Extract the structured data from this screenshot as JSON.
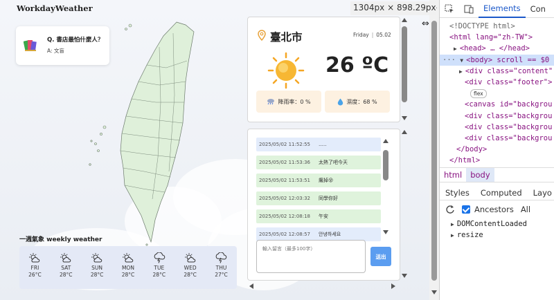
{
  "page": {
    "brand": "WorkdayWeather",
    "qa": {
      "question": "Q. 書店最怕什麼人？",
      "answer": "A: 文盲"
    },
    "weekly": {
      "title": "一週氣象 weekly weather",
      "days": [
        {
          "day": "FRI",
          "temp": "26°C",
          "icon": "partly-sunny-icon"
        },
        {
          "day": "SAT",
          "temp": "28°C",
          "icon": "partly-sunny-icon"
        },
        {
          "day": "SUN",
          "temp": "28°C",
          "icon": "partly-sunny-icon"
        },
        {
          "day": "MON",
          "temp": "28°C",
          "icon": "partly-sunny-icon"
        },
        {
          "day": "TUE",
          "temp": "28°C",
          "icon": "thunderstorm-icon"
        },
        {
          "day": "WED",
          "temp": "28°C",
          "icon": "partly-sunny-icon"
        },
        {
          "day": "THU",
          "temp": "27°C",
          "icon": "thunderstorm-icon"
        }
      ]
    },
    "current": {
      "city": "臺北市",
      "weekday": "Friday",
      "separator": "|",
      "date": "05.02",
      "temperature": "26 ºC",
      "rain": "降雨率：0 %",
      "humidity": "濕度：68 %"
    },
    "chat": {
      "messages": [
        {
          "time": "2025/05/02 11:52:55",
          "text": "…..",
          "color": "blue"
        },
        {
          "time": "2025/05/02 11:53:36",
          "text": "太熱了吧今天",
          "color": "green"
        },
        {
          "time": "2025/05/02 11:53:51",
          "text": "癱掉😵",
          "color": "green"
        },
        {
          "time": "2025/05/02 12:03:32",
          "text": "同學你好",
          "color": "green"
        },
        {
          "time": "2025/05/02 12:08:18",
          "text": "午安",
          "color": "green"
        },
        {
          "time": "2025/05/02 12:08:57",
          "text": "안녕하세요",
          "color": "blue"
        }
      ],
      "placeholder": "輸入留言（最多100字）",
      "send": "送出"
    }
  },
  "viewport_size": "1304px × 898.29px",
  "devtools": {
    "tabs": [
      "Elements",
      "Con"
    ],
    "code": [
      "<!DOCTYPE html>",
      "<html lang=\"zh-TW\">",
      "<head> … </head>",
      "<body> scroll == $0",
      "<div class=\"content\"",
      "<div class=\"footer\">",
      "flex",
      "<canvas id=\"backgrou",
      "<div class=\"backgrou",
      "<div class=\"backgrou",
      "<div class=\"backgrou",
      "</body>",
      "</html>"
    ],
    "crumbs": [
      "html",
      "body"
    ],
    "subtabs": [
      "Styles",
      "Computed",
      "Layo"
    ],
    "ancestors": "Ancestors",
    "all": "All",
    "events": [
      "DOMContentLoaded",
      "resize"
    ]
  },
  "colors": {
    "accent_blue": "#5b9df0",
    "chat_blue": "#e3ecfb",
    "chat_green": "#dff3dc",
    "pill": "#fdf1e1",
    "devtools_active": "#1a57c9"
  }
}
